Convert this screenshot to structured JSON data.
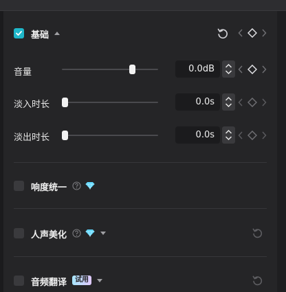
{
  "basic": {
    "title": "基础"
  },
  "volume": {
    "label": "音量",
    "value": "0.0dB",
    "level": 0.7
  },
  "fade_in": {
    "label": "淡入时长",
    "value": "0.0s",
    "level": 0.0
  },
  "fade_out": {
    "label": "淡出时长",
    "value": "0.0s",
    "level": 0.0
  },
  "loudness_norm": {
    "label": "响度统一"
  },
  "voice_enhance": {
    "label": "人声美化"
  },
  "audio_translate": {
    "label": "音频翻译",
    "badge": "试用"
  },
  "colors": {
    "accent": "#1fb7c9",
    "panel": "#252527",
    "gem": "#5fd8ff"
  }
}
